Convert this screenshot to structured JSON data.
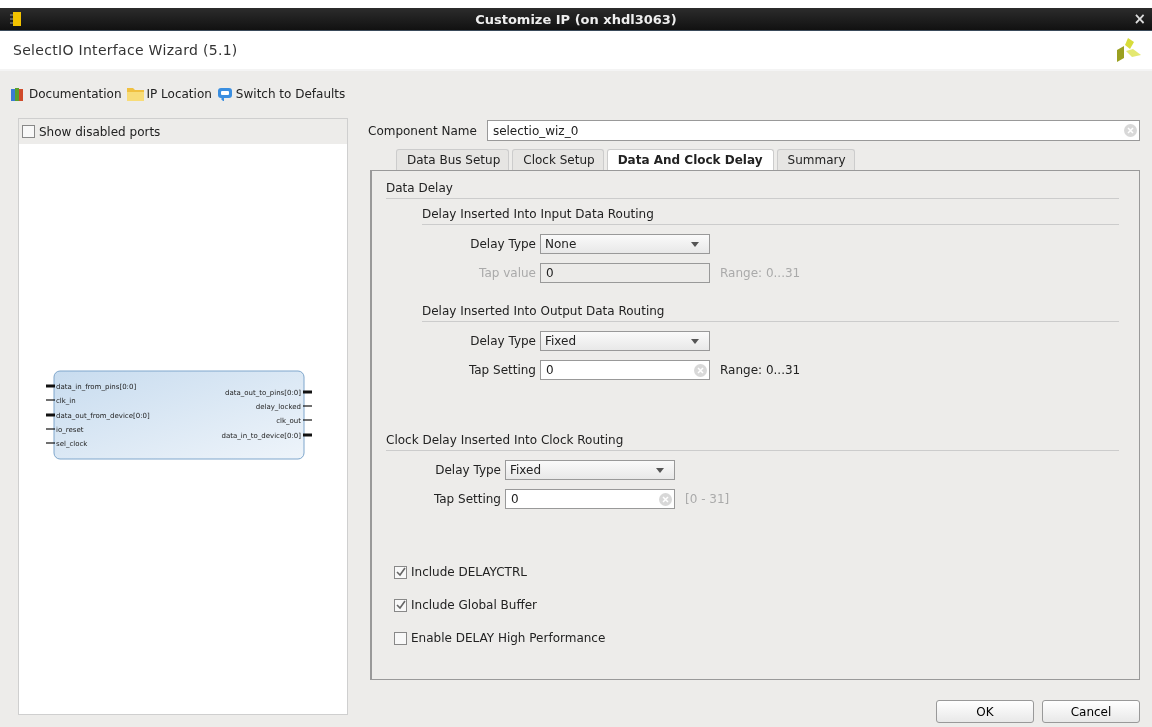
{
  "window": {
    "title": "Customize IP (on xhdl3063)",
    "close": "×"
  },
  "header": {
    "title": "SelectIO Interface Wizard (5.1)"
  },
  "toolbar": [
    {
      "kind": "book",
      "label": "Documentation"
    },
    {
      "kind": "folder",
      "label": "IP Location"
    },
    {
      "kind": "reset",
      "label": "Switch to Defaults"
    }
  ],
  "symbol_panel": {
    "show_disabled_ports": {
      "label": "Show disabled ports",
      "checked": false
    },
    "left_ports": [
      {
        "name": "data_in_from_pins[0:0]",
        "kind": "bus"
      },
      {
        "name": "clk_in",
        "kind": "wire"
      },
      {
        "name": "data_out_from_device[0:0]",
        "kind": "bus"
      },
      {
        "name": "io_reset",
        "kind": "wire"
      },
      {
        "name": "sel_clock",
        "kind": "wire"
      }
    ],
    "right_ports": [
      {
        "name": "data_out_to_pins[0:0]",
        "kind": "bus"
      },
      {
        "name": "delay_locked",
        "kind": "wire"
      },
      {
        "name": "clk_out",
        "kind": "wire"
      },
      {
        "name": "data_in_to_device[0:0]",
        "kind": "bus"
      }
    ]
  },
  "component_name": {
    "label": "Component Name",
    "value": "selectio_wiz_0"
  },
  "tabs": [
    {
      "label": "Data Bus Setup",
      "selected": false
    },
    {
      "label": "Clock Setup",
      "selected": false
    },
    {
      "label": "Data And Clock Delay",
      "selected": true
    },
    {
      "label": "Summary",
      "selected": false
    }
  ],
  "groups": [
    {
      "title": "Data Delay",
      "children": [
        {
          "title": "Delay Inserted Into Input Data Routing",
          "rows": [
            {
              "kind": "dropdown",
              "label": "Delay Type",
              "value": "None",
              "disabled": false
            },
            {
              "kind": "text",
              "label": "Tap value",
              "value": "0",
              "disabled": true,
              "hint": "Range: 0...31",
              "hint_muted": true
            }
          ]
        },
        {
          "title": "Delay Inserted Into Output Data Routing",
          "rows": [
            {
              "kind": "dropdown",
              "label": "Delay Type",
              "value": "Fixed",
              "disabled": false
            },
            {
              "kind": "text",
              "label": "Tap Setting",
              "value": "0",
              "disabled": false,
              "hint": "Range: 0...31",
              "hint_muted": false
            }
          ]
        }
      ]
    },
    {
      "title": "Clock Delay Inserted Into Clock Routing",
      "rows": [
        {
          "kind": "dropdown",
          "label": "Delay Type",
          "value": "Fixed",
          "disabled": false
        },
        {
          "kind": "text",
          "label": "Tap Setting",
          "value": "0",
          "disabled": false,
          "hint": "[0 - 31]",
          "hint_muted": true
        }
      ]
    }
  ],
  "options": [
    {
      "label": "Include DELAYCTRL",
      "checked": true
    },
    {
      "label": "Include Global Buffer",
      "checked": true
    },
    {
      "label": "Enable DELAY High Performance",
      "checked": false
    }
  ],
  "buttons": [
    "OK",
    "Cancel"
  ]
}
